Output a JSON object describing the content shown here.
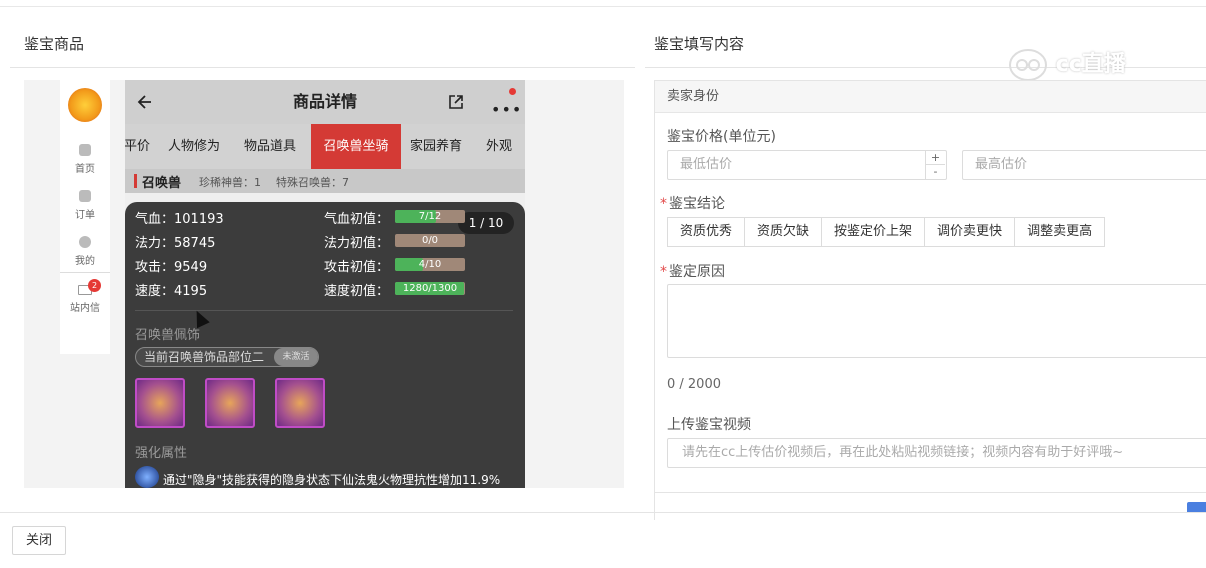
{
  "left_panel": {
    "title": "鉴宝商品"
  },
  "right_panel": {
    "title": "鉴宝填写内容"
  },
  "watermark": "cc直播",
  "preview": {
    "sidebar": [
      {
        "label": "首页",
        "icon": "home-icon"
      },
      {
        "label": "订单",
        "icon": "order-icon"
      },
      {
        "label": "我的",
        "icon": "user-icon"
      },
      {
        "label": "站内信",
        "icon": "mail-icon",
        "badge": "2"
      }
    ],
    "header_title": "商品详情",
    "tabs": [
      "平价",
      "人物修为",
      "物品道具",
      "召唤兽坐骑",
      "家园养育",
      "外观"
    ],
    "active_tab": "召唤兽坐骑",
    "sub": {
      "title": "召唤兽",
      "rare": "珍稀神兽：1",
      "special": "特殊召唤兽：7"
    },
    "pager": "1 / 10",
    "stats": [
      {
        "label": "气血：101193"
      },
      {
        "label": "法力：58745"
      },
      {
        "label": "攻击：9549"
      },
      {
        "label": "速度：4195"
      }
    ],
    "initials": [
      {
        "label": "气血初值：",
        "value": "7/12",
        "ratio": 0.58
      },
      {
        "label": "法力初值：",
        "value": "0/0",
        "ratio": 0
      },
      {
        "label": "攻击初值：",
        "value": "4/10",
        "ratio": 0.4
      },
      {
        "label": "速度初值：",
        "value": "1280/1300",
        "ratio": 0.98
      }
    ],
    "accessory_title": "召唤兽佩饰",
    "accessory_pill": "当前召唤兽饰品部位二",
    "accessory_badge": "未激活",
    "enhance_title": "强化属性",
    "enhance_text": "通过\"隐身\"技能获得的隐身状态下仙法鬼火物理抗性增加11.9%"
  },
  "form": {
    "seller_section": "卖家身份",
    "price_label": "鉴宝价格(单位元)",
    "min_placeholder": "最低估价",
    "max_placeholder": "最高估价",
    "conclusion_label": "鉴宝结论",
    "conclusion_options": [
      "资质优秀",
      "资质欠缺",
      "按鉴定价上架",
      "调价卖更快",
      "调整卖更高"
    ],
    "reason_label": "鉴定原因",
    "reason_counter": "0 / 2000",
    "video_label": "上传鉴宝视频",
    "video_placeholder": "请先在cc上传估价视频后，再在此处粘贴视频链接；视频内容有助于好评哦~",
    "required_mark": "*"
  },
  "footer": {
    "close_label": "关闭"
  },
  "colors": {
    "accent_red": "#d43a35",
    "bar_green": "#4db35a",
    "primary_blue": "#4a7fe0"
  }
}
